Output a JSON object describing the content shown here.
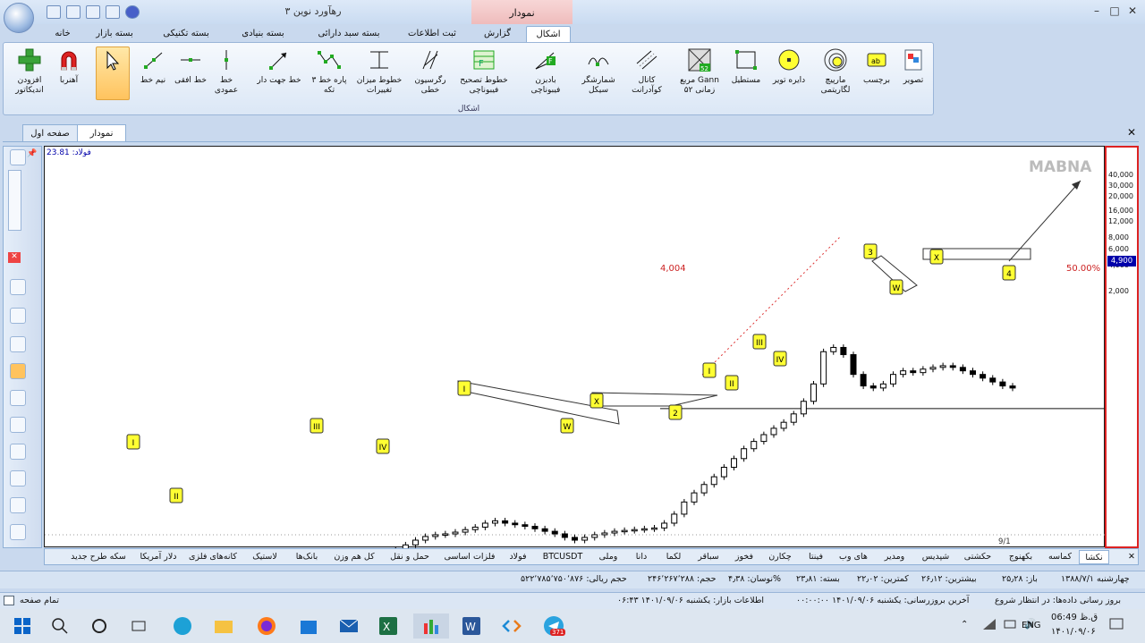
{
  "window": {
    "title": "رهآورد نوین ۳",
    "context_tab_header": "نمودار"
  },
  "tabs": [
    "خانه",
    "بسته بازار",
    "بسته تکنیکی",
    "بسته بنیادی",
    "بسته سبد دارائی",
    "ثبت اطلاعات",
    "گزارش",
    "اشکال"
  ],
  "ribbon": {
    "group_label": "اشکال",
    "buttons": [
      {
        "label": "افزودن اندیکاتور",
        "icon": "add-indicator-icon"
      },
      {
        "label": "آهنربا",
        "icon": "magnet-icon"
      },
      {
        "label": "",
        "icon": "cursor-icon"
      },
      {
        "label": "نیم خط",
        "icon": "ray-icon"
      },
      {
        "label": "خط افقی",
        "icon": "horizontal-line-icon"
      },
      {
        "label": "خط عمودی",
        "icon": "vertical-line-icon"
      },
      {
        "label": "خط جهت دار",
        "icon": "arrow-line-icon"
      },
      {
        "label": "پاره خط ۳ تکه",
        "icon": "segment-3-icon"
      },
      {
        "label": "خطوط میزان تغییرات",
        "icon": "change-lines-icon"
      },
      {
        "label": "رگرسیون خطی",
        "icon": "regression-icon"
      },
      {
        "label": "خطوط تصحیح فیبوناچی",
        "icon": "fib-retracement-icon"
      },
      {
        "label": "بادبزن فیبوناچی",
        "icon": "fib-fan-icon"
      },
      {
        "label": "شمارشگر سیکل",
        "icon": "cycle-counter-icon"
      },
      {
        "label": "کانال کوآدرانت",
        "icon": "quadrant-channel-icon"
      },
      {
        "label": "مربع Gann زمانی ۵۲",
        "icon": "gann-square-icon"
      },
      {
        "label": "مستطیل",
        "icon": "rectangle-icon"
      },
      {
        "label": "دایره تویر",
        "icon": "circle-icon"
      },
      {
        "label": "مارپیچ لگاریتمی",
        "icon": "log-spiral-icon"
      },
      {
        "label": "برچسب",
        "icon": "label-icon"
      },
      {
        "label": "تصویر",
        "icon": "image-icon"
      }
    ]
  },
  "doc_tabs": [
    "نمودار",
    "صفحه اول"
  ],
  "chart": {
    "symbol_value": "فولاد: 23.81",
    "watermark": "MABNA",
    "fib_left": "4,004",
    "fib_right": "50.00%",
    "current_price": "4,900",
    "date_label": "9/1",
    "y_ticks": [
      "40,000",
      "30,000",
      "20,000",
      "16,000",
      "12,000",
      "8,000",
      "6,000",
      "4,000",
      "2,000"
    ],
    "wave_labels": [
      "I",
      "II",
      "III",
      "IV",
      "I",
      "W",
      "X",
      "2",
      "I",
      "II",
      "III",
      "IV",
      "3",
      "W",
      "X",
      "4"
    ]
  },
  "chart_data": {
    "type": "candlestick",
    "y_scale": "log",
    "ylim": [
      1100,
      48000
    ],
    "x_date_label": "9/1",
    "close_approx": [
      420,
      430,
      460,
      520,
      540,
      560,
      580,
      590,
      620,
      650,
      700,
      640,
      560,
      500,
      470,
      470,
      490,
      520,
      560,
      560,
      570,
      590,
      620,
      650,
      660,
      680,
      720,
      760,
      800,
      820,
      860,
      880,
      900,
      920,
      1000,
      1050,
      1100,
      1140,
      1160,
      1170,
      1190,
      1220,
      1250,
      1300,
      1330,
      1300,
      1280,
      1260,
      1230,
      1200,
      1170,
      1130,
      1100,
      1130,
      1160,
      1180,
      1200,
      1210,
      1220,
      1230,
      1240,
      1300,
      1420,
      1600,
      1750,
      1900,
      2050,
      2250,
      2450,
      2700,
      2900,
      3100,
      3300,
      3500,
      3800,
      4300,
      5100,
      7000,
      7300,
      6800,
      5600,
      5000,
      4900,
      5100,
      5600,
      5800,
      5700,
      5900,
      6000,
      6100,
      6000,
      5800,
      5600,
      5400,
      5200,
      5000,
      4900
    ]
  },
  "sym_tabs": [
    "نکشا",
    "کماسه",
    "بکهنوج",
    "حکشتی",
    "شپدیس",
    "ومدیر",
    "های وب",
    "فینتا",
    "چکارن",
    "فخوز",
    "سباقر",
    "لکما",
    "دانا",
    "وملی",
    "BTCUSDT",
    "فولاد",
    "فلزات اساسی",
    "حمل و نقل",
    "کل هم وزن",
    "بانک‌ها",
    "لاستیک",
    "کانه‌های فلزی",
    "دلار آمریکا",
    "سکه طرح جدید"
  ],
  "info_bar": [
    "چهارشنبه ۱۳۸۸/۷/۱",
    "باز: ۲۵٫۲۸",
    "بیشترین: ۲۶٫۱۲",
    "کمترین: ۲۲٫۰۲",
    "بسته: ۲۳٫۸۱",
    "نوسان: ۴٫۳۸%",
    "حجم: ۲۴۶٬۲۶۷٬۲۸۸",
    "حجم ریالی: ۵۲۲٬۷۸۵٬۷۵۰٬۸۷۶"
  ],
  "status_bar": {
    "left": "تمام صفحه",
    "middle": "اطلاعات بازار: یکشنبه ۱۴۰۱/۰۹/۰۶  ۰۶:۴۳",
    "right": "آخرین بروزرسانی: یکشنبه ۱۴۰۱/۰۹/۰۶  ۰۰:۰۰:۰۰",
    "far_right": "بروز رسانی داده‌ها: در انتظار شروع"
  },
  "taskbar": {
    "time": "06:49 ق.ظ",
    "date": "۱۴۰۱/۰۹/۰۶",
    "lang": "ENG",
    "badge": "371"
  }
}
